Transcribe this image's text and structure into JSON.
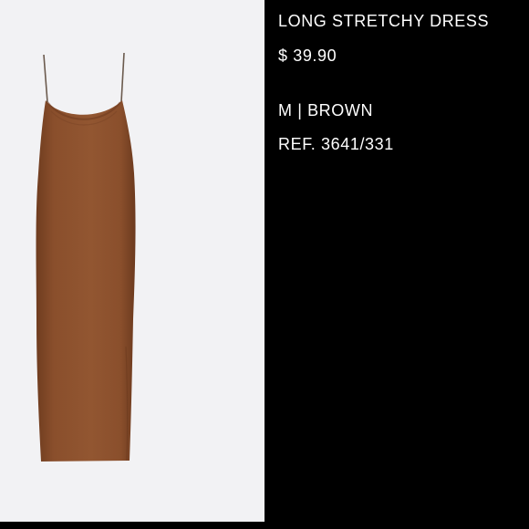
{
  "product": {
    "name": "LONG STRETCHY DRESS",
    "price": "$ 39.90",
    "variant": "M | BROWN",
    "reference": "REF. 3641/331"
  },
  "image": {
    "subject": "dress-image",
    "colors": {
      "background": "#f2f2f4",
      "dress": "#8a4f2c",
      "dress_shadow": "#6f3c1f",
      "strap": "#6b5a4d"
    }
  },
  "theme": {
    "info_background": "#000000",
    "text_color": "#ffffff"
  }
}
